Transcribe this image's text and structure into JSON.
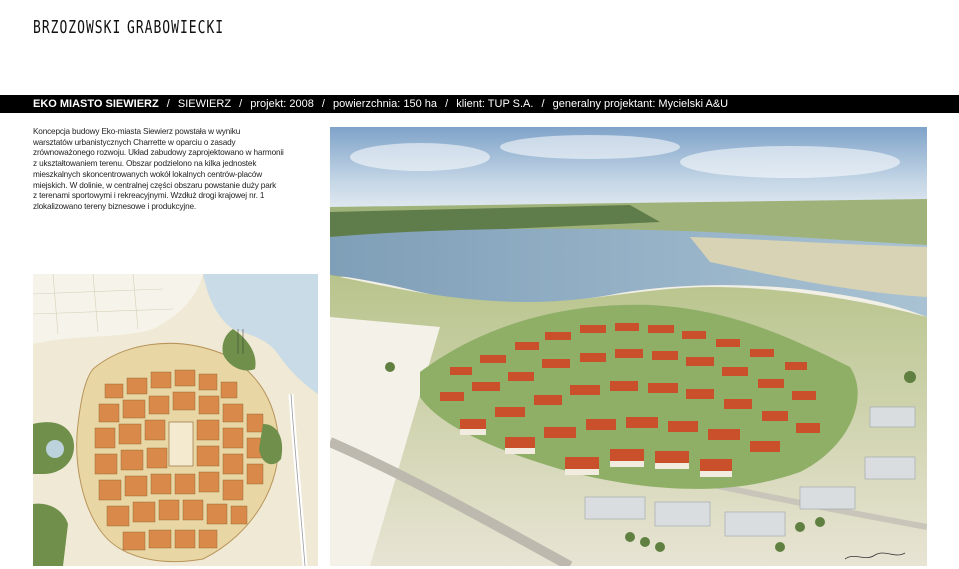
{
  "logo": {
    "left_word": "BRZOZOWSKI",
    "right_word": "GRABOWIECKI"
  },
  "header": {
    "project_name": "EKO MIASTO SIEWIERZ",
    "separator": "/",
    "location": "SIEWIERZ",
    "project_year": "projekt: 2008",
    "area": "powierzchnia: 150 ha",
    "client": "klient: TUP S.A.",
    "designer": "generalny projektant: Mycielski A&U"
  },
  "description": {
    "lines": [
      "Koncepcja budowy Eko-miasta Siewierz powstała w wyniku",
      "warsztatów urbanistycznych Charrette w oparciu o zasady",
      "zrównoważonego rozwoju. Układ zabudowy zaprojektowano w harmonii",
      "z ukształtowaniem terenu. Obszar podzielono na kilka jednostek",
      "mieszkalnych skoncentrowanych wokół lokalnych centrów-placów",
      "miejskich. W dolinie, w centralnej części obszaru powstanie duży park",
      "z terenami sportowymi i rekreacyjnymi. Wzdłuż drogi krajowej nr. 1",
      "zlokalizowano tereny biznesowe i produkcyjne."
    ]
  },
  "images": {
    "site_plan": "site-plan",
    "aerial_view": "aerial-watercolor"
  },
  "colors": {
    "band": "#000000",
    "water": "#7fa6bf",
    "sky": "#9fbcd6",
    "roofs": "#c9502a",
    "green": "#7f9e52"
  }
}
